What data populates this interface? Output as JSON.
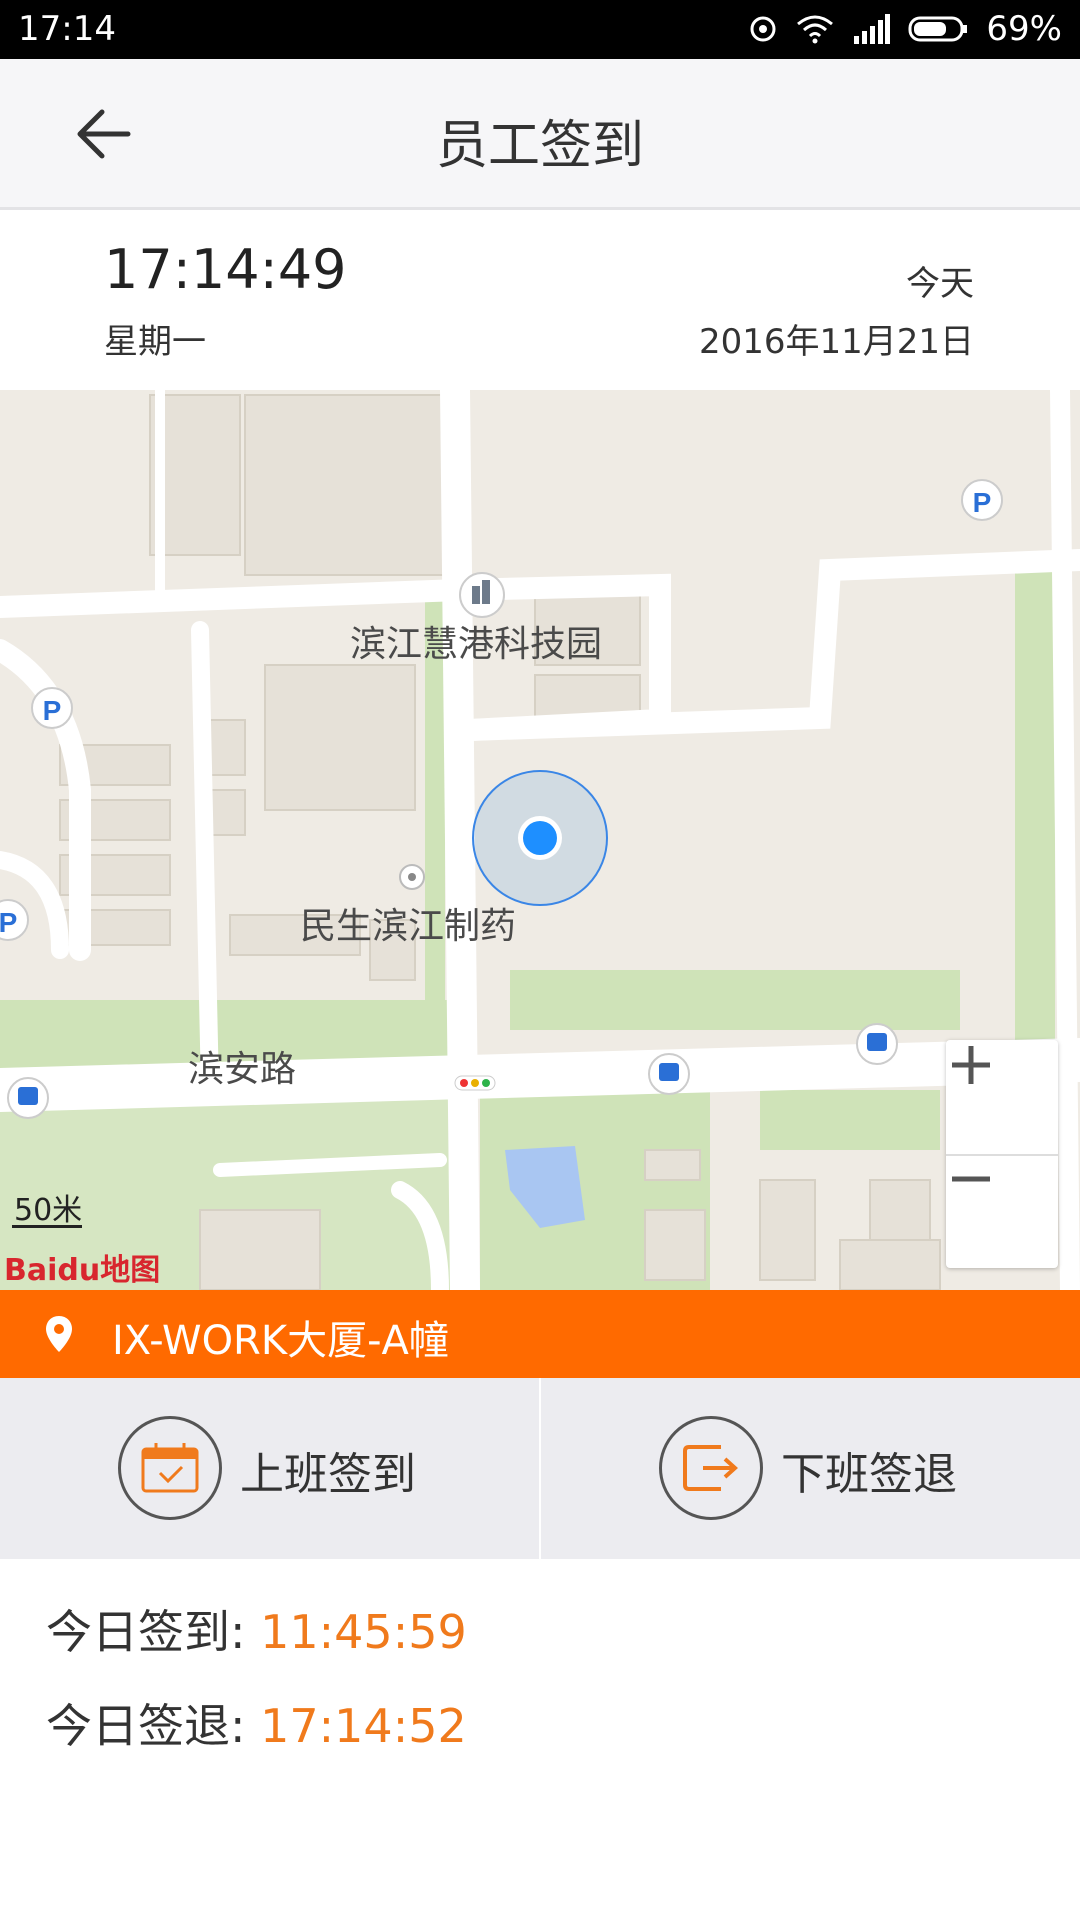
{
  "status_bar": {
    "time": "17:14",
    "battery": "69%"
  },
  "header": {
    "title": "员工签到"
  },
  "date_info": {
    "clock": "17:14:49",
    "weekday": "星期一",
    "today_label": "今天",
    "date": "2016年11月21日"
  },
  "map": {
    "labels": {
      "tech_park": "滨江慧港科技园",
      "pharma": "民生滨江制药",
      "road": "滨安路"
    },
    "scale": "50米",
    "logo": "Baidu地图"
  },
  "location": {
    "name": "IX-WORK大厦-A幢"
  },
  "actions": {
    "check_in": "上班签到",
    "check_out": "下班签退"
  },
  "records": {
    "check_in_label": "今日签到:",
    "check_in_time": "11:45:59",
    "check_out_label": "今日签退:",
    "check_out_time": "17:14:52"
  },
  "colors": {
    "accent": "#ff6a00",
    "time_value": "#f07a1c",
    "location_dot": "#1e8fff"
  }
}
